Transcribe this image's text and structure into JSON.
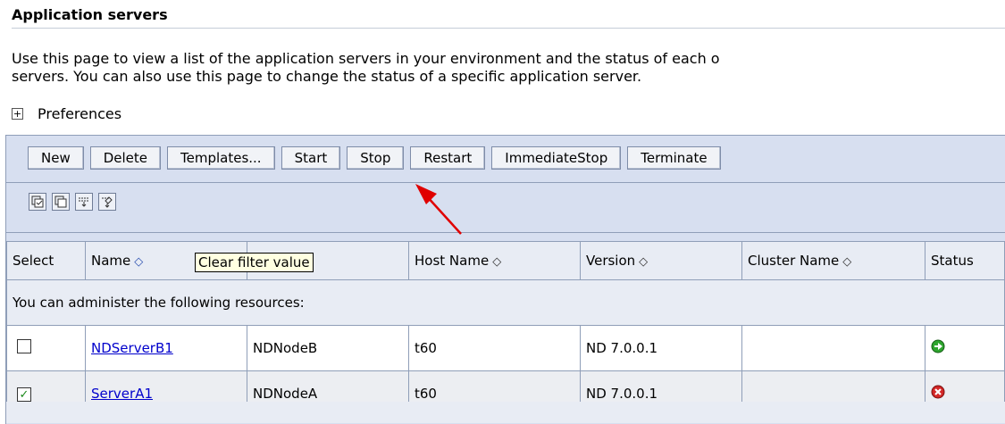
{
  "page": {
    "title": "Application servers",
    "description_line1": "Use this page to view a list of the application servers in your environment and the status of each o",
    "description_line2": "servers. You can also use this page to change the status of a specific application server.",
    "preferences_label": "Preferences"
  },
  "toolbar": {
    "new_label": "New",
    "delete_label": "Delete",
    "templates_label": "Templates...",
    "start_label": "Start",
    "stop_label": "Stop",
    "restart_label": "Restart",
    "immediatestop_label": "ImmediateStop",
    "terminate_label": "Terminate"
  },
  "table": {
    "headers": {
      "select": "Select",
      "name": "Name",
      "host": "Host Name",
      "version": "Version",
      "cluster": "Cluster Name",
      "status": "Status"
    },
    "group_label": "You can administer the following resources:",
    "rows": [
      {
        "name": "NDServerB1",
        "node": "NDNodeB",
        "host": "t60",
        "version": "ND 7.0.0.1",
        "cluster": "",
        "checked": false,
        "status": "started"
      },
      {
        "name": "ServerA1",
        "node": "NDNodeA",
        "host": "t60",
        "version": "ND 7.0.0.1",
        "cluster": "",
        "checked": true,
        "status": "stopped"
      }
    ]
  },
  "tooltip": {
    "text": "Clear filter value"
  },
  "icons": {
    "expand": "plus-box-icon",
    "sort": "sort-arrows-icon",
    "status_started": "green-arrow-icon",
    "status_stopped": "red-x-icon",
    "annotation": "red-arrow"
  },
  "colors": {
    "link": "#0000cc",
    "annotation_arrow": "#e00000",
    "frame_bg": "#d7dff0"
  }
}
